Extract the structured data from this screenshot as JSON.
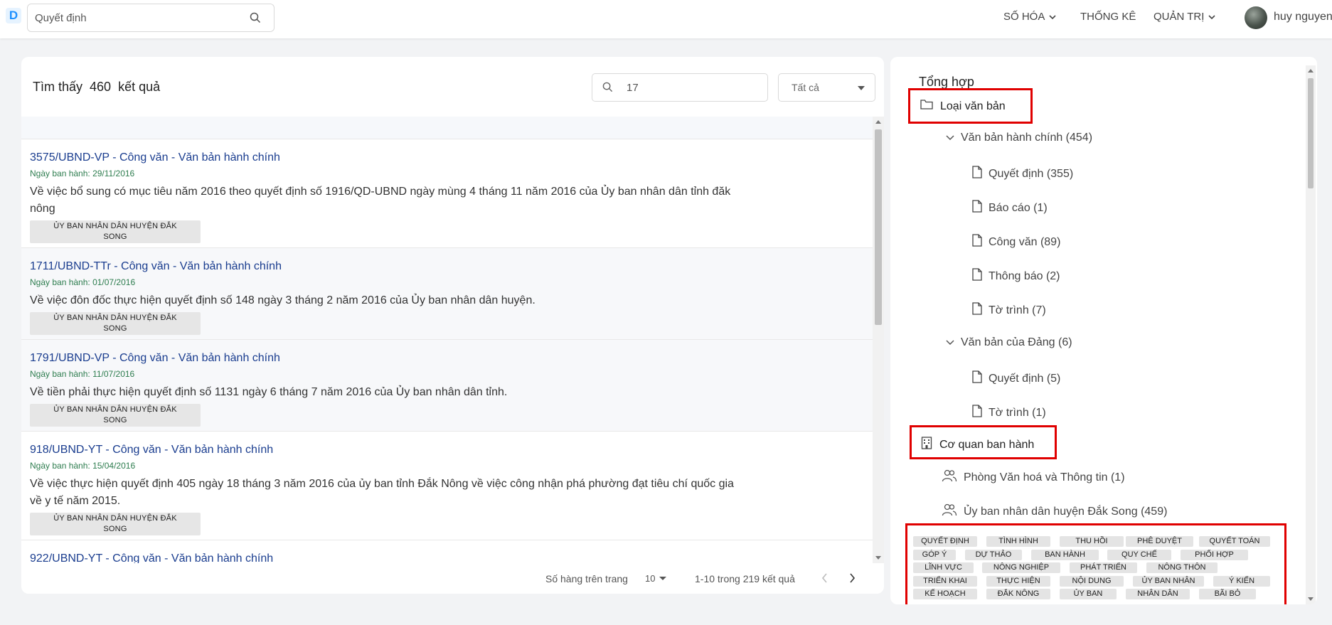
{
  "header": {
    "logo": "D",
    "search_value": "Quyết định",
    "nav": [
      {
        "label": "SỐ HÓA",
        "has_caret": true
      },
      {
        "label": "THỐNG KÊ",
        "has_caret": false
      },
      {
        "label": "QUẢN TRỊ",
        "has_caret": true
      }
    ],
    "user_name": "huy nguyen"
  },
  "results": {
    "found_prefix": "Tìm thấy",
    "found_count": "460",
    "found_suffix": "kết quả",
    "filter_value": "17",
    "filter_select": "Tất cả",
    "items": [
      {
        "title": "3575/UBND-VP - Công văn - Văn bản hành chính",
        "date": "Ngày ban hành: 29/11/2016",
        "summary": "Về việc bổ sung có mục tiêu năm 2016 theo quyết định số 1916/QD-UBND ngày mùng 4 tháng 11 năm 2016 của Ủy ban nhân dân tỉnh đăk nông",
        "agency": "ỦY BAN NHÂN DÂN HUYỆN ĐẮK SONG"
      },
      {
        "title": "1711/UBND-TTr - Công văn - Văn bản hành chính",
        "date": "Ngày ban hành: 01/07/2016",
        "summary": "Về việc đôn đốc thực hiện quyết định số 148 ngày 3 tháng 2 năm 2016 của Ủy ban nhân dân huyện.",
        "agency": "ỦY BAN NHÂN DÂN HUYỆN ĐẮK SONG"
      },
      {
        "title": "1791/UBND-VP - Công văn - Văn bản hành chính",
        "date": "Ngày ban hành: 11/07/2016",
        "summary": "Về tiền phải thực hiện quyết định số 1131  ngày 6 tháng 7 năm 2016 của Ủy ban nhân dân tỉnh.",
        "agency": "ỦY BAN NHÂN DÂN HUYỆN ĐẮK SONG"
      },
      {
        "title": "918/UBND-YT - Công văn - Văn bản hành chính",
        "date": "Ngày ban hành: 15/04/2016",
        "summary": "Về việc thực hiện quyết định 405 ngày 18 tháng 3 năm 2016 của ủy ban tỉnh Đắk Nông về việc công nhận phá phường đạt tiêu chí quốc gia về y tế năm 2015.",
        "agency": "ỦY BAN NHÂN DÂN HUYỆN ĐẮK SONG"
      },
      {
        "title": "922/UBND-YT - Công văn - Văn bản hành chính",
        "date": "",
        "summary": "",
        "agency": ""
      }
    ],
    "pager": {
      "rows_label": "Số hàng trên trang",
      "rows_value": "10",
      "range": "1-10 trong 219 kết quả"
    }
  },
  "summary": {
    "title": "Tổng hợp",
    "doc_type_label": "Loại văn bản",
    "admin_group": "Văn bản hành chính (454)",
    "admin_items": [
      "Quyết định (355)",
      "Báo cáo (1)",
      "Công văn (89)",
      "Thông báo (2)",
      "Tờ trình (7)"
    ],
    "party_group": "Văn bản của Đảng (6)",
    "party_items": [
      "Quyết định (5)",
      "Tờ trình (1)"
    ],
    "agency_label": "Cơ quan ban hành",
    "agencies": [
      "Phòng Văn hoá và Thông tin (1)",
      "Ủy ban nhân dân huyện Đắk Song (459)"
    ],
    "keywords": [
      "QUYẾT ĐỊNH",
      "TÌNH HÌNH",
      "THU HỒI",
      "PHÊ DUYỆT",
      "QUYẾT TOÁN",
      "GÓP Ý",
      "DỰ THẢO",
      "BAN HÀNH",
      "QUY CHẾ",
      "PHỐI HỢP",
      "LĨNH VỰC",
      "NÔNG NGHIỆP",
      "PHÁT TRIỂN",
      "NÔNG THÔN",
      "TRIỂN KHAI",
      "THỰC HIỆN",
      "NỘI DUNG",
      "ỦY BAN NHÂN",
      "Ý KIẾN",
      "KẾ HOẠCH",
      "ĐẮK NÔNG",
      "ỦY BAN",
      "NHÂN DÂN",
      "BÃI BỎ"
    ]
  },
  "colors": {
    "accent": "#1a3d8f",
    "date_green": "#2e7d4f",
    "highlight_red": "#e00000"
  }
}
